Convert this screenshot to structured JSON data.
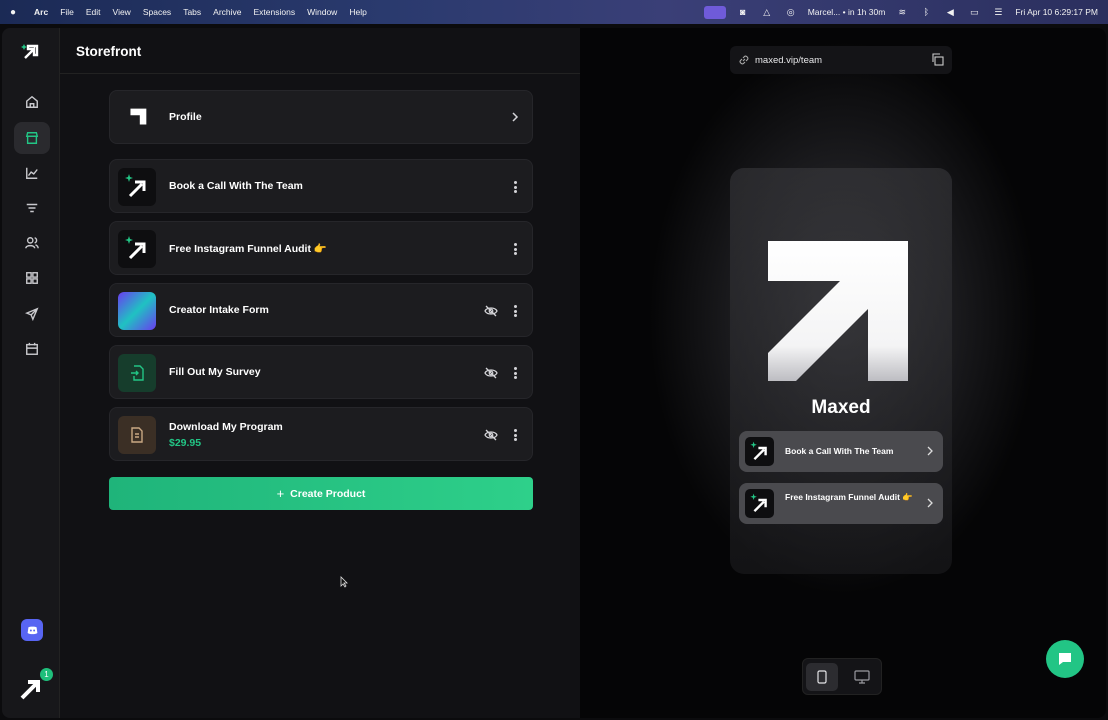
{
  "menubar": {
    "app": "Arc",
    "items": [
      "File",
      "Edit",
      "View",
      "Spaces",
      "Tabs",
      "Archive",
      "Extensions",
      "Window",
      "Help"
    ],
    "reminder": "Marcel... • in 1h 30m",
    "datetime": "Fri Apr 10  6:29:17 PM"
  },
  "sidebar": {
    "items": [
      "home-icon",
      "storefront-icon",
      "analytics-icon",
      "funnel-icon",
      "customers-icon",
      "apps-icon",
      "send-icon",
      "calendar-icon"
    ],
    "notification_count": "1",
    "accent": "#22c585"
  },
  "header": {
    "title": "Storefront"
  },
  "cards": [
    {
      "title": "Profile"
    },
    {
      "title": "Book a Call With The Team"
    },
    {
      "title": "Free Instagram Funnel Audit 👉"
    },
    {
      "title": "Creator Intake Form"
    },
    {
      "title": "Fill Out My Survey"
    },
    {
      "title": "Download My Program",
      "price": "$29.95"
    }
  ],
  "create_button": {
    "label": "Create Product",
    "icon": "plus-icon"
  },
  "preview": {
    "url": "maxed.vip/team",
    "brand": "Maxed",
    "links": [
      {
        "title": "Book a Call With The Team"
      },
      {
        "title": "Free Instagram Funnel Audit 👉"
      }
    ]
  }
}
